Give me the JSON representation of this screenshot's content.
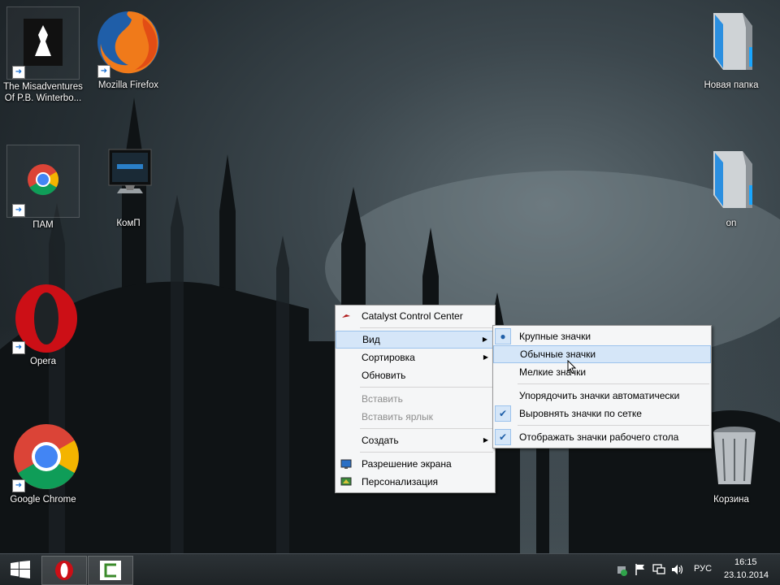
{
  "desktop": {
    "icons": [
      {
        "label": "The Misadventures Of P.B. Winterbo..."
      },
      {
        "label": "Mozilla Firefox"
      },
      {
        "label": "Новая папка"
      },
      {
        "label": "ПАМ"
      },
      {
        "label": "КомП"
      },
      {
        "label": "on"
      },
      {
        "label": "Opera"
      },
      {
        "label": "Google Chrome"
      },
      {
        "label": "Корзина"
      }
    ]
  },
  "context_menu": {
    "items": [
      {
        "label": "Catalyst Control Center"
      },
      {
        "label": "Вид"
      },
      {
        "label": "Сортировка"
      },
      {
        "label": "Обновить"
      },
      {
        "label": "Вставить"
      },
      {
        "label": "Вставить ярлык"
      },
      {
        "label": "Создать"
      },
      {
        "label": "Разрешение экрана"
      },
      {
        "label": "Персонализация"
      }
    ]
  },
  "view_submenu": {
    "items": [
      {
        "label": "Крупные значки",
        "selected": true
      },
      {
        "label": "Обычные значки",
        "hovered": true
      },
      {
        "label": "Мелкие значки"
      },
      {
        "label": "Упорядочить значки автоматически"
      },
      {
        "label": "Выровнять значки по сетке",
        "checked": true
      },
      {
        "label": "Отображать значки рабочего стола",
        "checked": true
      }
    ]
  },
  "taskbar": {
    "language": "РУС",
    "time": "16:15",
    "date": "23.10.2014"
  },
  "colors": {
    "menu_highlight": "#d5e6f8",
    "taskbar": "#1e2326",
    "opera_red": "#cc0f16"
  }
}
